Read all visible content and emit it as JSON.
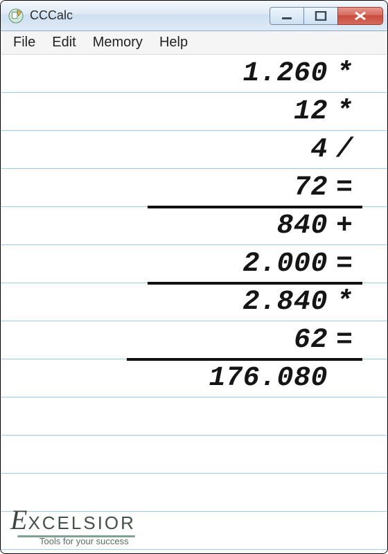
{
  "window": {
    "title": "CCCalc"
  },
  "menu": {
    "file": "File",
    "edit": "Edit",
    "memory": "Memory",
    "help": "Help"
  },
  "tape": [
    {
      "value": "1.260",
      "op": "*",
      "underline": false
    },
    {
      "value": "12",
      "op": "*",
      "underline": false
    },
    {
      "value": "4",
      "op": "/",
      "underline": false
    },
    {
      "value": "72",
      "op": "=",
      "underline": true,
      "ulw": 310
    },
    {
      "value": "840",
      "op": "+",
      "underline": false
    },
    {
      "value": "2.000",
      "op": "=",
      "underline": true,
      "ulw": 310
    },
    {
      "value": "2.840",
      "op": "*",
      "underline": false
    },
    {
      "value": "62",
      "op": "=",
      "underline": true,
      "ulw": 340
    },
    {
      "value": "176.080",
      "op": "",
      "underline": false
    }
  ],
  "brand": {
    "name_first": "E",
    "name_rest": "XCELSIOR",
    "tagline": "Tools for your success"
  }
}
